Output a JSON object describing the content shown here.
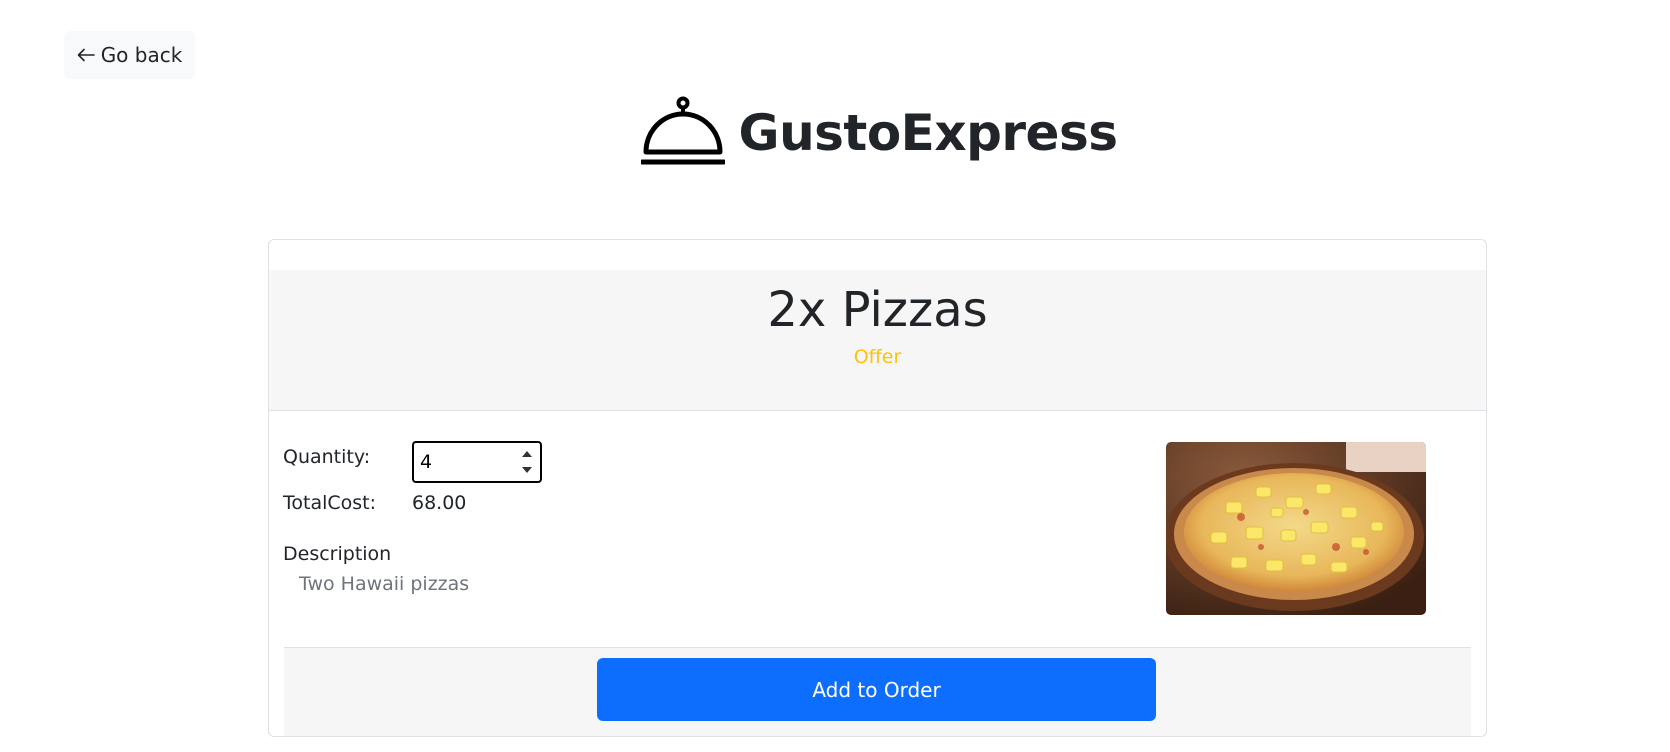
{
  "nav": {
    "back_label": "Go back"
  },
  "brand": {
    "name": "GustoExpress",
    "icon": "cloche-icon"
  },
  "product": {
    "title": "2x Pizzas",
    "badge": "Offer",
    "quantity_label": "Quantity:",
    "quantity_value": "4",
    "total_cost_label": "TotalCost:",
    "total_cost_value": "68.00",
    "description_label": "Description",
    "description_text": "Two Hawaii pizzas",
    "image": "hawaiian-pizza-photo"
  },
  "actions": {
    "add_to_order_label": "Add to Order"
  },
  "colors": {
    "primary": "#0d6efd",
    "badge": "#ffc107",
    "text": "#212529",
    "muted": "#6c757d",
    "panel": "#f6f6f6"
  }
}
